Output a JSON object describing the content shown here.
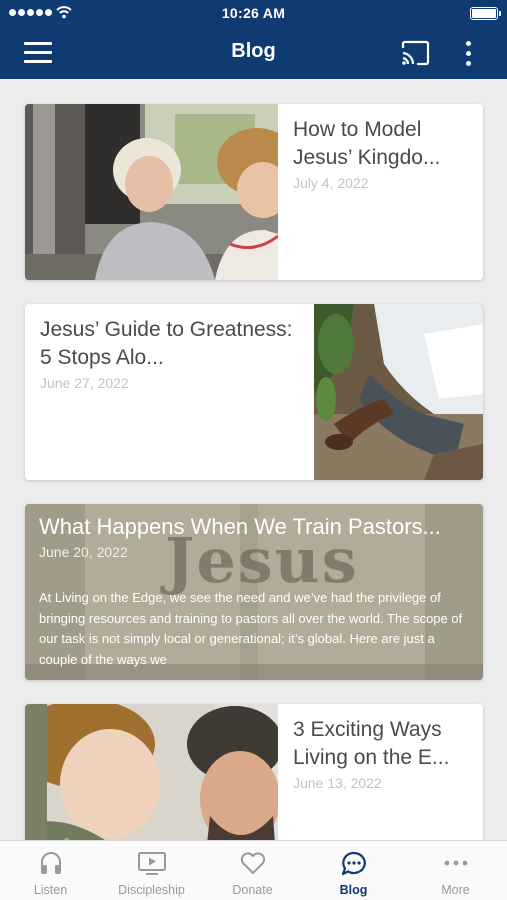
{
  "status_bar": {
    "time": "10:26 AM"
  },
  "header": {
    "title": "Blog",
    "menu_icon": "hamburger-menu-icon",
    "cast_icon": "cast-icon",
    "overflow_icon": "more-vertical-icon"
  },
  "posts": [
    {
      "title": "How to Model Jesus’ Kingdo...",
      "date": "July 4, 2022"
    },
    {
      "title": "Jesus’ Guide to Greatness: 5 Stops Alo...",
      "date": "June 27, 2022"
    },
    {
      "title": "What Happens When We Train Pastors...",
      "date": "June 20, 2022",
      "excerpt": "At Living on the Edge, we see the need and we’ve had the privilege of bringing resources and training to pastors all over the world. The scope of our task is not simply local or generational; it’s global. Here are just a couple of the ways we",
      "background_word": "Jesus"
    },
    {
      "title": "3 Exciting Ways Living on the E...",
      "date": "June 13, 2022"
    }
  ],
  "tabs": [
    {
      "label": "Listen",
      "icon": "headphones-icon"
    },
    {
      "label": "Discipleship",
      "icon": "video-play-icon"
    },
    {
      "label": "Donate",
      "icon": "heart-icon"
    },
    {
      "label": "Blog",
      "icon": "chat-bubble-icon",
      "active": true
    },
    {
      "label": "More",
      "icon": "more-horizontal-icon"
    }
  ],
  "colors": {
    "header_bg": "#0f3a72",
    "tab_active": "#0f3a72",
    "tab_inactive": "#9a9a9a"
  }
}
